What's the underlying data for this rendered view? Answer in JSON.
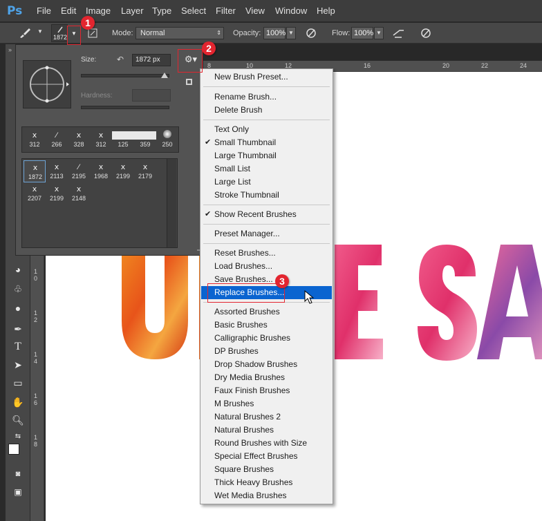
{
  "app": {
    "logo_text": "Ps"
  },
  "menubar": {
    "items": [
      "File",
      "Edit",
      "Image",
      "Layer",
      "Type",
      "Select",
      "Filter",
      "View",
      "Window",
      "Help"
    ]
  },
  "options_bar": {
    "brush_size_value": "1872",
    "mode_label": "Mode:",
    "mode_value": "Normal",
    "opacity_label": "Opacity:",
    "opacity_value": "100%",
    "flow_label": "Flow:",
    "flow_value": "100%"
  },
  "ruler_top": [
    "8",
    "10",
    "12",
    "16",
    "20",
    "22",
    "24"
  ],
  "ruler_left": [
    "1",
    "0",
    "1",
    "2",
    "1",
    "4",
    "1",
    "6",
    "1",
    "8"
  ],
  "picker": {
    "size_label": "Size:",
    "size_value": "1872 px",
    "hardness_label": "Hardness:",
    "recent_brushes": [
      "312",
      "266",
      "328",
      "312",
      "125",
      "359",
      "250"
    ],
    "presets": [
      "1872",
      "2113",
      "2195",
      "1968",
      "2199",
      "2179",
      "2207",
      "2199",
      "2148"
    ]
  },
  "dropdown": {
    "new_preset": "New Brush Preset...",
    "rename": "Rename Brush...",
    "delete": "Delete Brush",
    "text_only": "Text Only",
    "small_thumb": "Small Thumbnail",
    "large_thumb": "Large Thumbnail",
    "small_list": "Small List",
    "large_list": "Large List",
    "stroke_thumb": "Stroke Thumbnail",
    "show_recent": "Show Recent Brushes",
    "preset_manager": "Preset Manager...",
    "reset": "Reset Brushes...",
    "load": "Load Brushes...",
    "save": "Save Brushes...",
    "replace": "Replace Brushes...",
    "libraries": [
      "Assorted Brushes",
      "Basic Brushes",
      "Calligraphic Brushes",
      "DP Brushes",
      "Drop Shadow Brushes",
      "Dry Media Brushes",
      "Faux Finish Brushes",
      "M Brushes",
      "Natural Brushes 2",
      "Natural Brushes",
      "Round Brushes with Size",
      "Special Effect Brushes",
      "Square Brushes",
      "Thick Heavy Brushes",
      "Wet Media Brushes"
    ]
  },
  "callouts": [
    "1",
    "2",
    "3"
  ],
  "colors": {
    "highlight": "#0a64d0",
    "annotation_red": "#e3252f",
    "ps_blue": "#4fa3e8"
  }
}
